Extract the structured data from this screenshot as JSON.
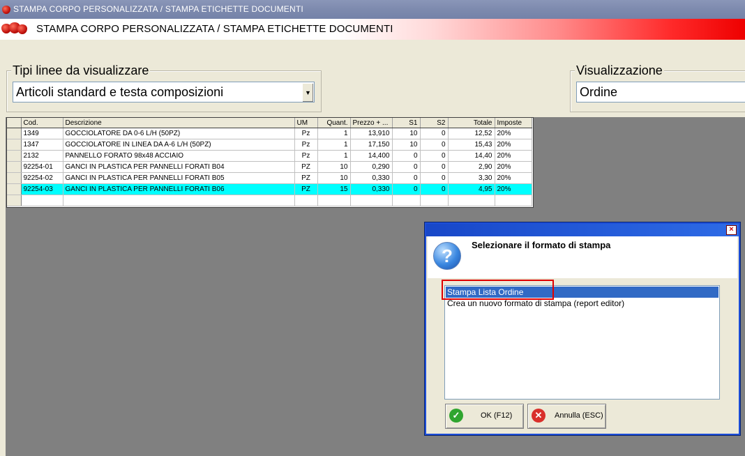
{
  "window": {
    "title": "STAMPA CORPO PERSONALIZZATA / STAMPA ETICHETTE DOCUMENTI",
    "header": "STAMPA CORPO PERSONALIZZATA / STAMPA ETICHETTE DOCUMENTI",
    "icon": "strawberry-icon"
  },
  "filters": {
    "line_types": {
      "legend": "Tipi linee da visualizzare",
      "value": "Articoli standard e testa composizioni"
    },
    "view": {
      "legend": "Visualizzazione",
      "value": "Ordine"
    }
  },
  "grid": {
    "columns": [
      "Cod.",
      "Descrizione",
      "UM",
      "Quant.",
      "Prezzo + ...",
      "S1",
      "S2",
      "Totale",
      "Imposte"
    ],
    "rows": [
      {
        "cod": "1349",
        "descr": "GOCCIOLATORE DA 0-6 L/H (50PZ)",
        "um": "Pz",
        "quant": "1",
        "prezzo": "13,910",
        "s1": "10",
        "s2": "0",
        "totale": "12,52",
        "imposte": "20%"
      },
      {
        "cod": "1347",
        "descr": "GOCCIOLATORE IN LINEA DA A-6 L/H (50PZ)",
        "um": "Pz",
        "quant": "1",
        "prezzo": "17,150",
        "s1": "10",
        "s2": "0",
        "totale": "15,43",
        "imposte": "20%"
      },
      {
        "cod": "2132",
        "descr": "PANNELLO FORATO 98x48 ACCIAIO",
        "um": "Pz",
        "quant": "1",
        "prezzo": "14,400",
        "s1": "0",
        "s2": "0",
        "totale": "14,40",
        "imposte": "20%"
      },
      {
        "cod": "92254-01",
        "descr": "GANCI IN PLASTICA PER PANNELLI FORATI B04",
        "um": "PZ",
        "quant": "10",
        "prezzo": "0,290",
        "s1": "0",
        "s2": "0",
        "totale": "2,90",
        "imposte": "20%"
      },
      {
        "cod": "92254-02",
        "descr": "GANCI IN PLASTICA PER PANNELLI FORATI B05",
        "um": "PZ",
        "quant": "10",
        "prezzo": "0,330",
        "s1": "0",
        "s2": "0",
        "totale": "3,30",
        "imposte": "20%"
      },
      {
        "cod": "92254-03",
        "descr": "GANCI IN PLASTICA PER PANNELLI FORATI B06",
        "um": "PZ",
        "quant": "15",
        "prezzo": "0,330",
        "s1": "0",
        "s2": "0",
        "totale": "4,95",
        "imposte": "20%",
        "selected": true
      }
    ]
  },
  "dialog": {
    "prompt": "Selezionare il formato di stampa",
    "icon": "question-icon",
    "options": [
      "Stampa Lista Ordine",
      "Crea un nuovo formato di stampa (report editor)"
    ],
    "selected_index": 0,
    "ok_label": "OK (F12)",
    "cancel_label": "Annulla (ESC)",
    "close_label": "×"
  },
  "colors": {
    "selected_row": "#00ffff",
    "highlight": "#e00000",
    "list_selection": "#316ac5"
  }
}
